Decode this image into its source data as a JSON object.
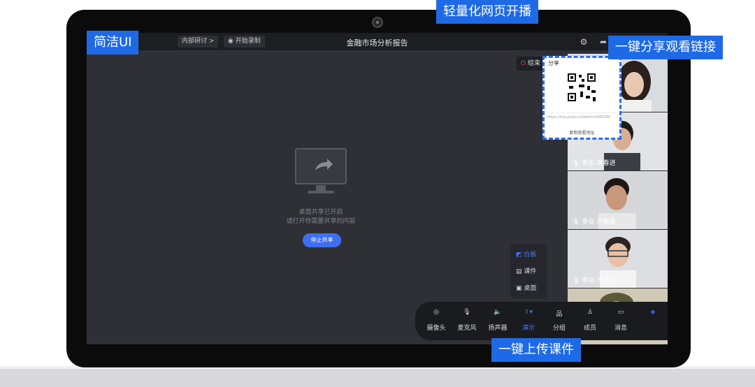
{
  "callouts": {
    "top": "轻量化网页开播",
    "left": "简洁UI",
    "right": "一键分享观看链接",
    "bottom": "一键上传课件"
  },
  "topbar": {
    "chip1": "内部研讨 >",
    "chip2": "开始录制",
    "title": "金融市场分析报告"
  },
  "center": {
    "line1": "桌面共享已开启",
    "line2": "请打开你需要共享的内容",
    "stop_button": "停止共享"
  },
  "end_button": "结束",
  "share": {
    "header": "分享",
    "url": "https://live.polyv.cn/watch/1846284",
    "copy": "复制观看地址"
  },
  "videos": [
    {
      "label": ""
    },
    {
      "label": "参会-袁春进"
    },
    {
      "label": "参会-邓敬强"
    },
    {
      "label": "参会-万才冰"
    },
    {
      "label": ""
    }
  ],
  "mini_menu": [
    {
      "label": "白板"
    },
    {
      "label": "课件"
    },
    {
      "label": "桌面"
    }
  ],
  "toolbar": [
    {
      "label": "摄像头",
      "icon": "camera-icon"
    },
    {
      "label": "麦克风",
      "icon": "microphone-icon"
    },
    {
      "label": "扬声器",
      "icon": "speaker-icon"
    },
    {
      "label": "演示",
      "icon": "upload-icon"
    },
    {
      "label": "分组",
      "icon": "group-icon"
    },
    {
      "label": "成员",
      "icon": "member-icon"
    },
    {
      "label": "消息",
      "icon": "message-icon"
    }
  ],
  "colors": {
    "accent": "#3e6ff2",
    "callout": "#1e6ae6",
    "end": "#ff4d4f"
  }
}
